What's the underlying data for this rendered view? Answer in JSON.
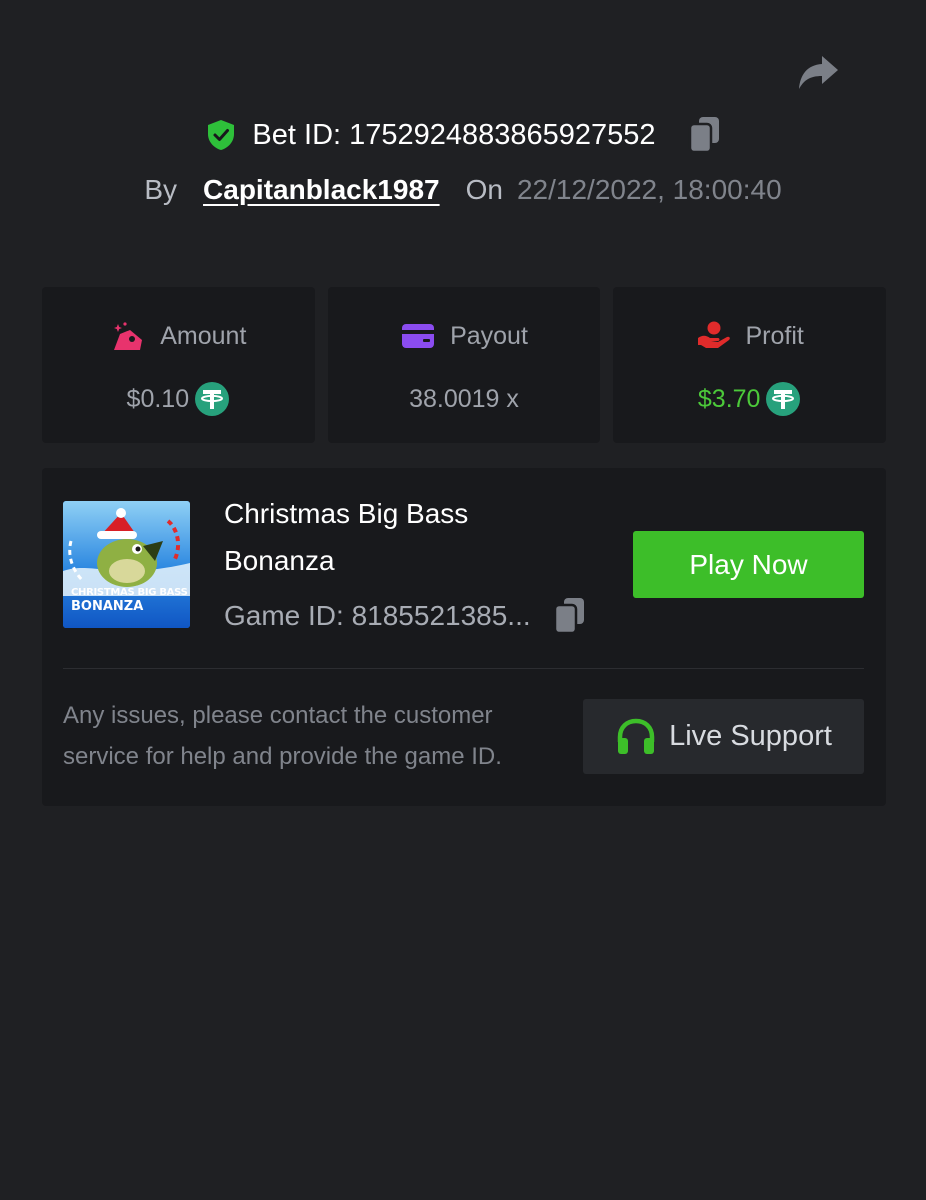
{
  "bet": {
    "label": "Bet ID: 1752924883865927552",
    "by_label": "By",
    "username": "Capitanblack1987",
    "on_label": "On",
    "datetime": "22/12/2022, 18:00:40"
  },
  "stats": [
    {
      "label": "Amount",
      "value": "$0.10",
      "icon": "gift-bag-icon",
      "currency_icon": "tether-icon"
    },
    {
      "label": "Payout",
      "value": "38.0019 x",
      "icon": "card-icon"
    },
    {
      "label": "Profit",
      "value": "$3.70",
      "icon": "hand-coin-icon",
      "currency_icon": "tether-icon",
      "value_color": "#4cc93a"
    }
  ],
  "game": {
    "title": "Christmas Big Bass Bonanza",
    "thumb_text_line1": "CHRISTMAS BIG BASS",
    "thumb_text_line2": "BONANZA",
    "game_id": "Game ID: 8185521385...",
    "play_label": "Play Now"
  },
  "support": {
    "help_text": "Any issues, please contact the customer service for help and provide the game ID.",
    "button_label": "Live Support"
  },
  "colors": {
    "background": "#1f2023",
    "card": "#18191c",
    "accent_green": "#3dbe29",
    "amount_icon": "#e8336d",
    "payout_icon": "#8b4cf0",
    "profit_icon": "#e02b2b",
    "tether": "#27a17c"
  }
}
